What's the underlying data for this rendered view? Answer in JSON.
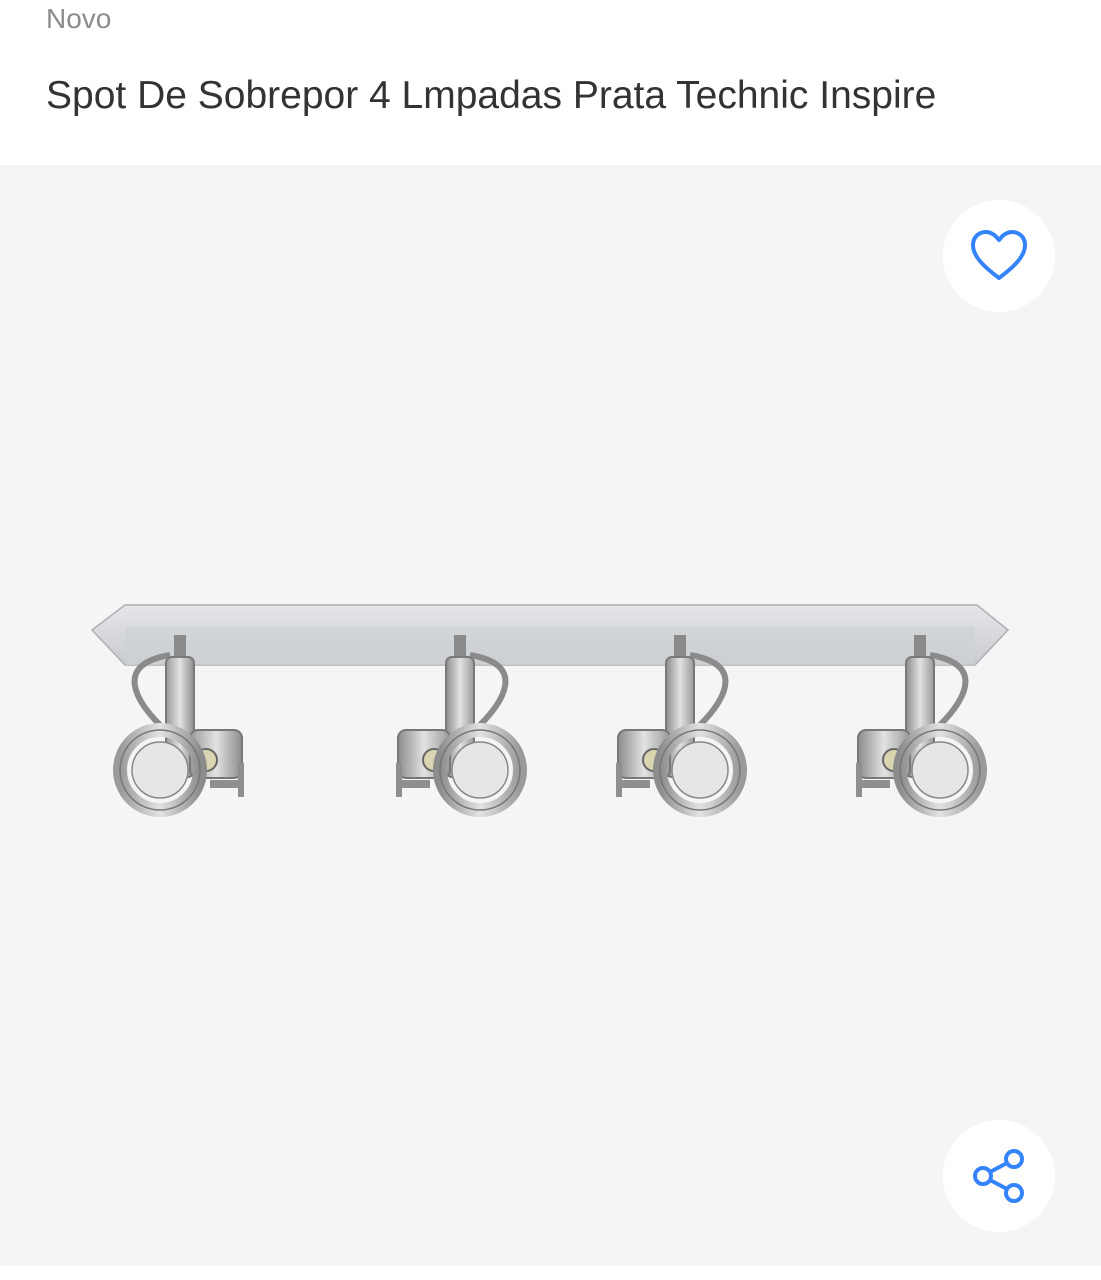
{
  "product": {
    "condition": "Novo",
    "title": "Spot De Sobrepor 4 Lmpadas Prata Technic Inspire"
  },
  "gallery": {
    "image_subject": "four-spot-ceiling-light-bar",
    "favorite_icon": "heart-outline-icon",
    "share_icon": "share-icon"
  },
  "colors": {
    "accent": "#3483fa",
    "gallery_background": "#f5f5f5",
    "title_text": "#333333",
    "condition_text": "#8c8c8c"
  }
}
